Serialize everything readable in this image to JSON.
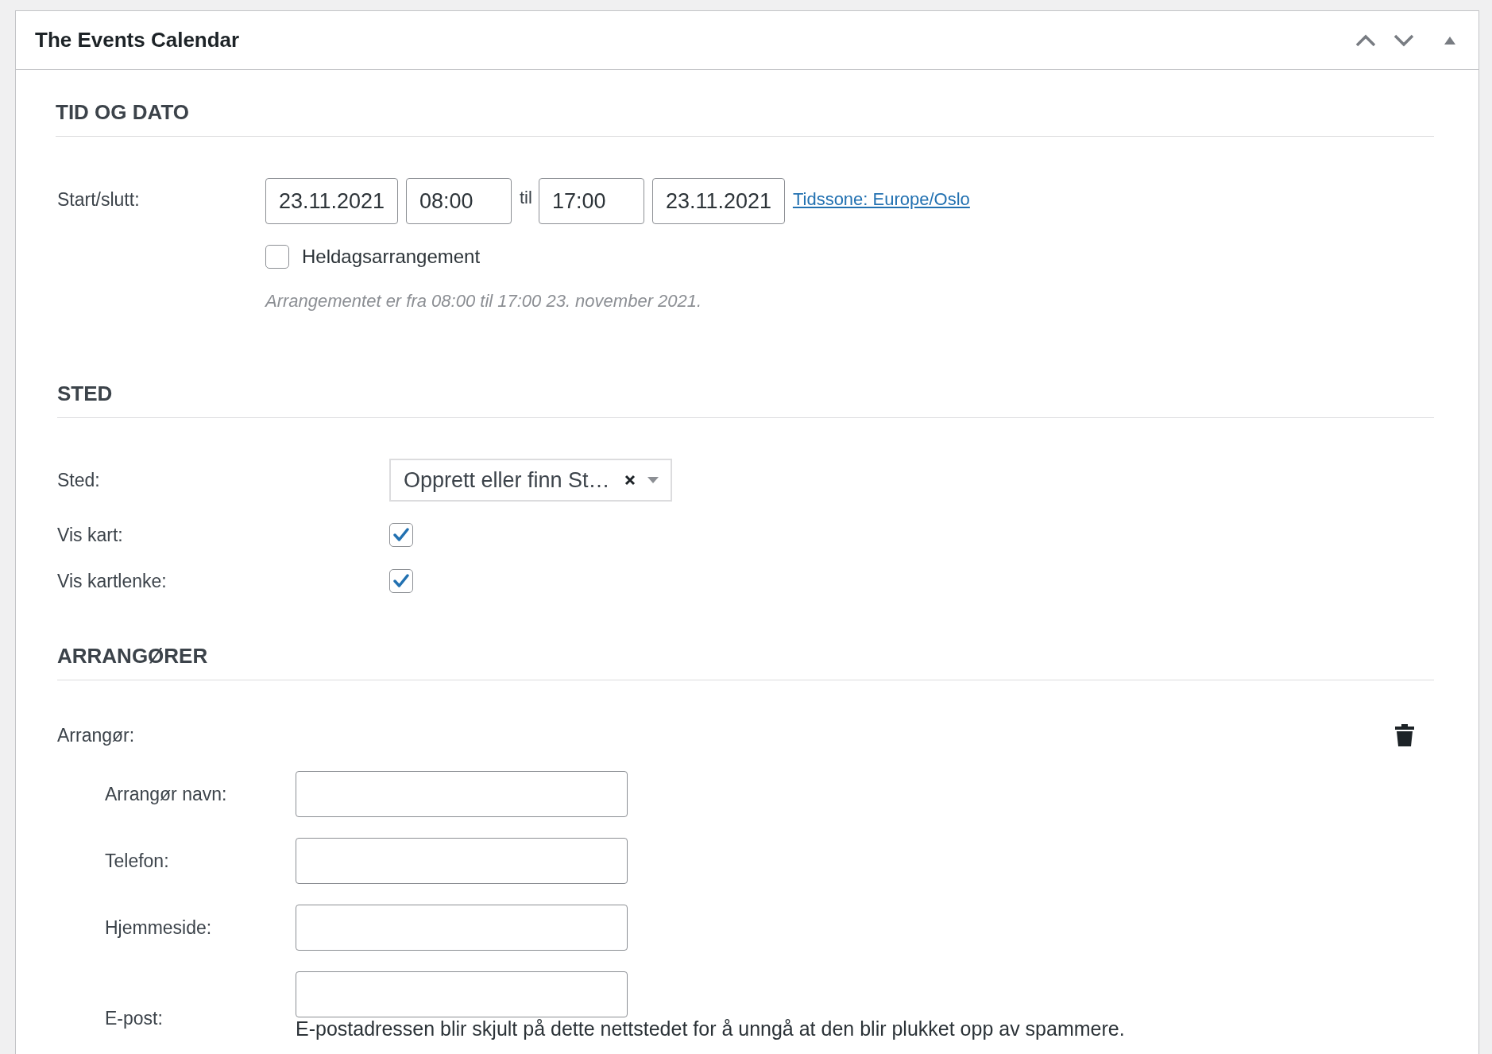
{
  "panel": {
    "title": "The Events Calendar"
  },
  "time_date": {
    "heading": "TID OG DATO",
    "label": "Start/slutt:",
    "start_date": "23.11.2021",
    "start_time": "08:00",
    "separator": "til",
    "end_time": "17:00",
    "end_date": "23.11.2021",
    "timezone_link": "Tidssone: Europe/Oslo",
    "all_day": {
      "label": "Heldagsarrangement",
      "checked": false
    },
    "summary": "Arrangementet er fra 08:00 til 17:00 23. november 2021."
  },
  "venue": {
    "heading": "STED",
    "rows": [
      {
        "kind": "select",
        "label": "Sted:",
        "value": "Opprett eller finn St…"
      },
      {
        "kind": "checkbox",
        "label": "Vis kart:",
        "checked": true
      },
      {
        "kind": "checkbox",
        "label": "Vis kartlenke:",
        "checked": true
      }
    ]
  },
  "organizers": {
    "heading": "ARRANGØRER",
    "label": "Arrangør:",
    "fields": [
      {
        "label": "Arrangør navn:"
      },
      {
        "label": "Telefon:"
      },
      {
        "label": "Hjemmeside:"
      },
      {
        "label": "E-post:",
        "help": "E-postadressen blir skjult på dette nettstedet for å unngå at den blir plukket opp av spammere."
      }
    ]
  }
}
